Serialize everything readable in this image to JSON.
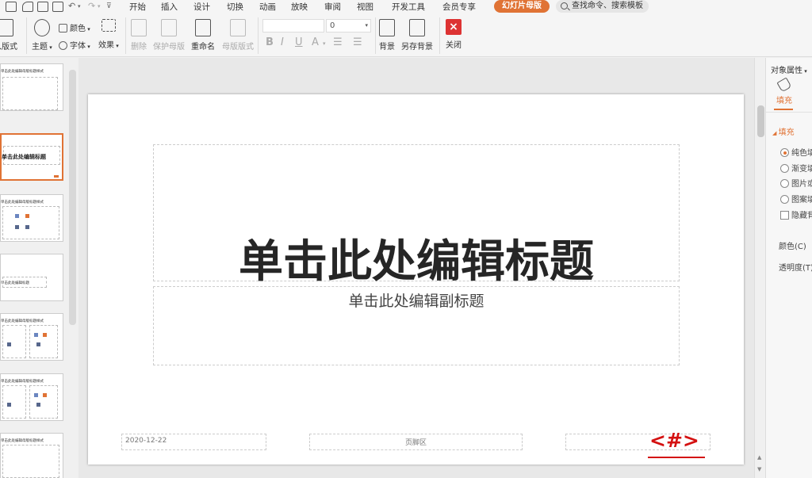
{
  "menubar": {
    "tabs": [
      "开始",
      "插入",
      "设计",
      "切换",
      "动画",
      "放映",
      "审阅",
      "视图",
      "开发工具",
      "会员专享"
    ],
    "active_tab": "幻灯片母版",
    "search_placeholder": "查找命令、搜索模板"
  },
  "ribbon": {
    "layout": "入版式",
    "theme": "主题",
    "colors": "颜色",
    "fonts": "字体",
    "effects": "效果",
    "delete": "删除",
    "protect_master": "保护母版",
    "rename": "重命名",
    "master_layout": "母版版式",
    "font_size": "0",
    "background": "背景",
    "save_background": "另存背景",
    "close": "关闭"
  },
  "thumbnails": {
    "items": [
      {
        "title": "单击此处编辑母版标题样式"
      },
      {
        "title": "单击此处编辑标题",
        "selected": true
      },
      {
        "title": "单击此处编辑母版标题样式"
      },
      {
        "title": "单击此处编辑标题"
      },
      {
        "title": "单击此处编辑母版标题样式"
      },
      {
        "title": "单击此处编辑母版标题样式"
      },
      {
        "title": "单击此处编辑母版标题样式"
      }
    ]
  },
  "slide": {
    "title": "单击此处编辑标题",
    "subtitle": "单击此处编辑副标题",
    "date": "2020-12-22",
    "footer": "页脚区",
    "slide_number": "<#>"
  },
  "properties": {
    "title": "对象属性",
    "tab_fill": "填充",
    "section": "填充",
    "options": [
      "纯色填",
      "渐变填",
      "图片或",
      "图案填"
    ],
    "hide_bg": "隐藏背",
    "color_label": "颜色(C)",
    "transparency_label": "透明度(T)"
  },
  "colors": {
    "accent": "#e07335",
    "slide_number": "#d41111"
  }
}
